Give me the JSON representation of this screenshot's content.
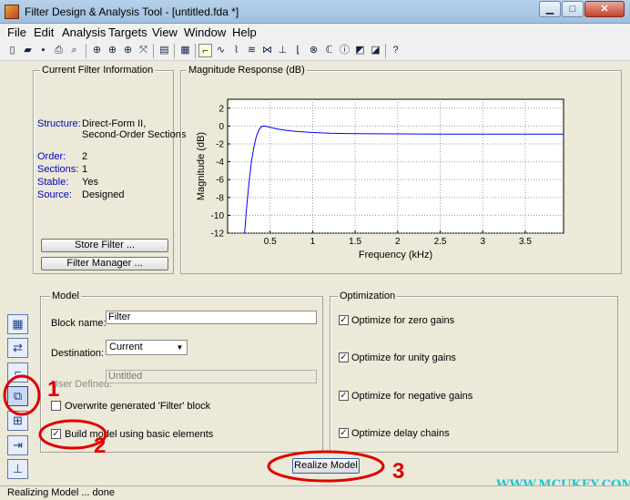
{
  "window": {
    "title": "Filter Design & Analysis Tool  -  [untitled.fda *]"
  },
  "menu": [
    "File",
    "Edit",
    "Analysis",
    "Targets",
    "View",
    "Window",
    "Help"
  ],
  "toolbar_icons": [
    "new-file-icon",
    "open-icon",
    "save-icon",
    "print-icon",
    "print-preview-icon",
    "zoom-in-icon",
    "zoom-x-icon",
    "zoom-y-icon",
    "full-view-icon",
    "legend-icon",
    "filter-specs-icon",
    "magnitude-response-icon",
    "phase-response-icon",
    "magnitude-phase-icon",
    "group-delay-icon",
    "phase-delay-icon",
    "impulse-response-icon",
    "step-response-icon",
    "pole-zero-icon",
    "coefficients-icon",
    "filter-info-icon",
    "magnitude-estimate-icon",
    "noise-power-icon",
    "whats-this-icon"
  ],
  "filter_info": {
    "title": "Current Filter Information",
    "structure_label": "Structure:",
    "structure_value_1": "Direct-Form II,",
    "structure_value_2": "Second-Order Sections",
    "order_label": "Order:",
    "order_value": "2",
    "sections_label": "Sections:",
    "sections_value": "1",
    "stable_label": "Stable:",
    "stable_value": "Yes",
    "source_label": "Source:",
    "source_value": "Designed",
    "store_button": "Store Filter ...",
    "manager_button": "Filter Manager ..."
  },
  "magnitude": {
    "title": "Magnitude Response (dB)",
    "chart_data": {
      "type": "line",
      "xlabel": "Frequency (kHz)",
      "ylabel": "Magnitude (dB)",
      "xlim": [
        0,
        3.95
      ],
      "ylim": [
        -12,
        3
      ],
      "xticks": [
        0.5,
        1,
        1.5,
        2,
        2.5,
        3,
        3.5
      ],
      "yticks": [
        2,
        0,
        -2,
        -4,
        -6,
        -8,
        -10,
        -12
      ],
      "grid": true,
      "color": "#0000ff",
      "x": [
        0.2,
        0.22,
        0.25,
        0.28,
        0.31,
        0.34,
        0.37,
        0.4,
        0.43,
        0.46,
        0.5,
        0.6,
        0.7,
        0.8,
        1.0,
        1.2,
        1.5,
        2.0,
        2.5,
        3.0,
        3.5,
        3.95
      ],
      "y": [
        -12,
        -9.5,
        -6.5,
        -4.0,
        -2.3,
        -1.1,
        -0.4,
        -0.05,
        0.0,
        -0.05,
        -0.15,
        -0.35,
        -0.5,
        -0.6,
        -0.72,
        -0.8,
        -0.85,
        -0.88,
        -0.9,
        -0.9,
        -0.9,
        -0.9
      ]
    }
  },
  "model": {
    "title": "Model",
    "block_name_label": "Block name:",
    "block_name_value": "Filter",
    "destination_label": "Destination:",
    "destination_value": "Current",
    "user_defined_label": "User Defined:",
    "user_defined_value": "Untitled",
    "overwrite_label": "Overwrite generated 'Filter' block",
    "overwrite_checked": false,
    "build_label": "Build model using basic elements",
    "build_checked": true
  },
  "optimization": {
    "title": "Optimization",
    "items": [
      {
        "label": "Optimize for zero gains",
        "checked": true
      },
      {
        "label": "Optimize for unity gains",
        "checked": true
      },
      {
        "label": "Optimize for negative gains",
        "checked": true
      },
      {
        "label": "Optimize delay chains",
        "checked": true
      }
    ]
  },
  "realize_button": "Realize Model",
  "sidebar_icons": [
    "design-filter-icon",
    "transform-filter-icon",
    "quantize-icon",
    "realize-model-icon",
    "multirate-icon",
    "import-filter-icon",
    "pole-zero-editor-icon"
  ],
  "annotations": {
    "n1": "1",
    "n2": "2",
    "n3": "3"
  },
  "watermark": "WWW.MCUKEY.COM",
  "status": "Realizing Model ... done"
}
